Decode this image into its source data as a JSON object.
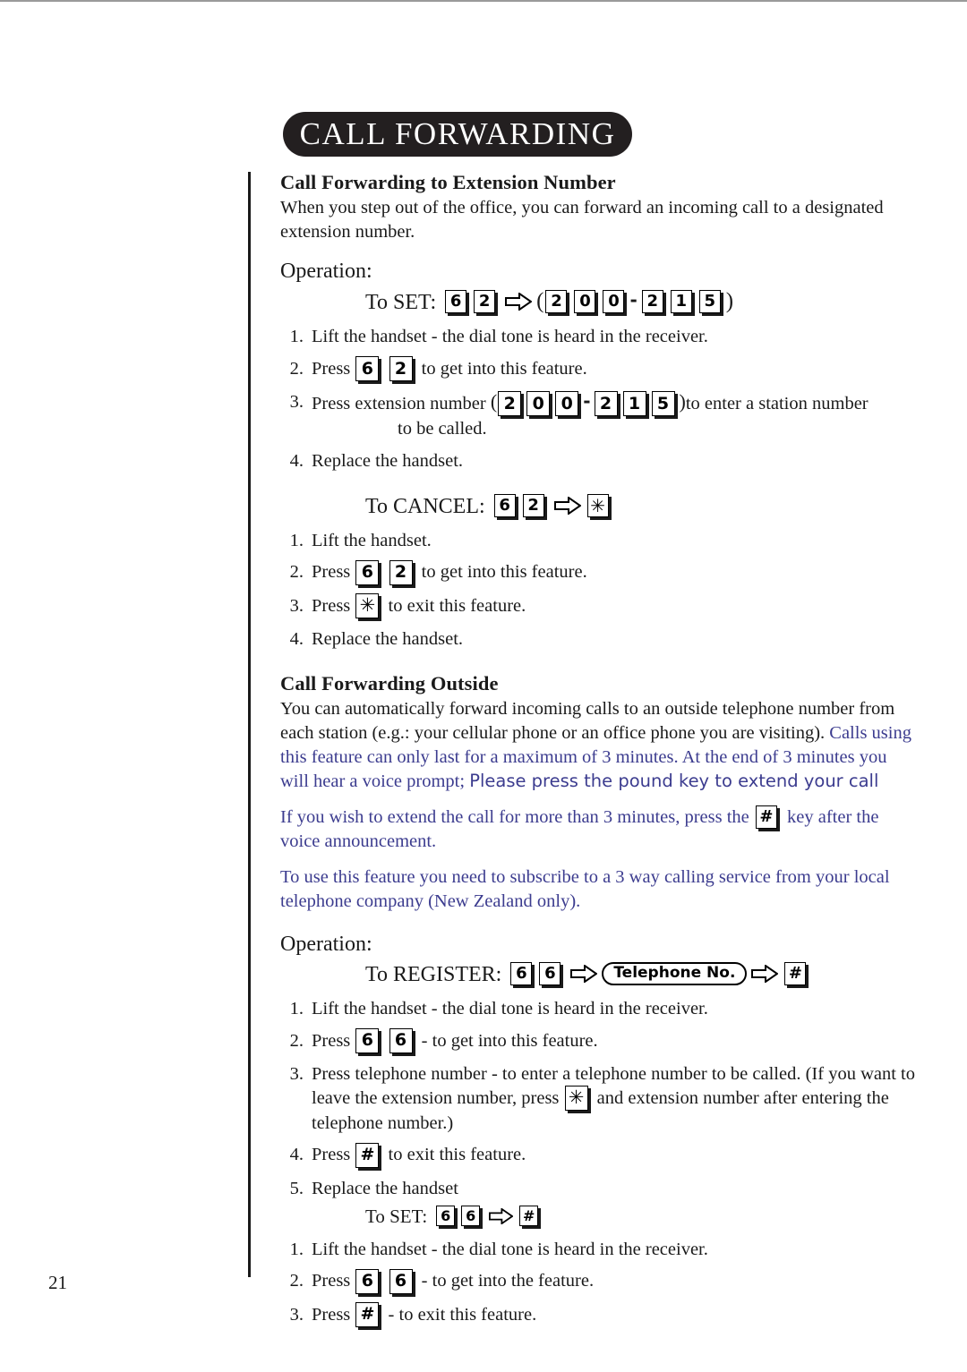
{
  "header": {
    "title": "CALL FORWARDING"
  },
  "page_number": "21",
  "colors": {
    "header_bg": "#231f20",
    "header_text": "#ffffff",
    "body_text": "#1a1a1a",
    "accent_blue": "#3c3c8f"
  },
  "sections": {
    "extension": {
      "heading": "Call Forwarding to Extension Number",
      "intro": "When you step out of the office, you can forward an incoming call to a designated extension number.",
      "operation_label": "Operation:",
      "set": {
        "label": "To SET:",
        "keys": [
          "6",
          "2"
        ],
        "arrow": "hollow-right-arrow",
        "open_paren": "(",
        "ext_keys_first": [
          "2",
          "0",
          "0"
        ],
        "ext_dash": "-",
        "ext_keys_second": [
          "2",
          "1",
          "5"
        ],
        "close_paren": ")",
        "steps": [
          {
            "num": "1.",
            "text": "Lift the handset - the dial tone is heard in the receiver."
          },
          {
            "num": "2.",
            "text_before": "Press",
            "keys": [
              "6",
              "2"
            ],
            "text_after": "to get into this feature."
          },
          {
            "num": "3.",
            "text_before": "Press extension number",
            "open_paren": "(",
            "keys_first": [
              "2",
              "0",
              "0"
            ],
            "dash": "-",
            "keys_second": [
              "2",
              "1",
              "5"
            ],
            "close_paren": ")",
            "text_after": "to enter a station number",
            "text_second_line": "to be called."
          },
          {
            "num": "4.",
            "text": "Replace the handset."
          }
        ]
      },
      "cancel": {
        "label": "To CANCEL:",
        "keys": [
          "6",
          "2"
        ],
        "arrow": "hollow-right-arrow",
        "star": "✳",
        "steps": [
          {
            "num": "1.",
            "text": "Lift the handset."
          },
          {
            "num": "2.",
            "text_before": "Press",
            "keys": [
              "6",
              "2"
            ],
            "text_after": "to get into this feature."
          },
          {
            "num": "3.",
            "text_before": "Press",
            "star": "✳",
            "text_after": "to exit this feature."
          },
          {
            "num": "4.",
            "text": "Replace the handset."
          }
        ]
      }
    },
    "outside": {
      "heading": "Call Forwarding Outside",
      "intro_black": "You can automatically forward incoming calls to an outside telephone number from each station (e.g.: your cellular phone or an office phone you are visiting).",
      "intro_blue": "Calls using this feature can only last for a maximum of 3 minutes.  At the end of 3 minutes you will hear a voice prompt;",
      "intro_blue_sans": "Please press the pound key to extend your call",
      "extend_para_before": "If you wish to extend the call for more than 3 minutes, press the",
      "extend_key": "#",
      "extend_para_after": "key after the voice announcement.",
      "subscribe_para": "To use this feature you need to subscribe to a 3 way calling service from your local telephone company (New Zealand only).",
      "operation_label": "Operation:",
      "register": {
        "label": "To REGISTER:",
        "keys": [
          "6",
          "6"
        ],
        "arrow": "hollow-right-arrow",
        "tel_pill": "Telephone No.",
        "arrow2": "hollow-right-arrow",
        "pound": "#",
        "steps": [
          {
            "num": "1.",
            "text": "Lift the handset - the dial tone is heard in the receiver."
          },
          {
            "num": "2.",
            "text_before": "Press",
            "keys": [
              "6",
              "6"
            ],
            "text_after": "- to get into this feature."
          },
          {
            "num": "3.",
            "text_before": "Press telephone number - to enter a telephone number to be called. (If you want to leave the extension number, press",
            "star": "✳",
            "text_after": "and extension number after entering the telephone number.)"
          },
          {
            "num": "4.",
            "text_before": "Press",
            "pound": "#",
            "text_after": "to exit this feature."
          },
          {
            "num": "5.",
            "text": "Replace the handset"
          }
        ]
      },
      "set": {
        "label": "To SET:",
        "keys": [
          "6",
          "6"
        ],
        "arrow": "hollow-right-arrow",
        "pound": "#",
        "steps": [
          {
            "num": "1.",
            "text": "Lift the handset - the dial tone is heard in the receiver."
          },
          {
            "num": "2.",
            "text_before": "Press",
            "keys": [
              "6",
              "6"
            ],
            "text_after": "- to get into the feature."
          },
          {
            "num": "3.",
            "text_before": "Press",
            "pound": "#",
            "text_after": "- to exit this feature."
          }
        ]
      }
    }
  }
}
